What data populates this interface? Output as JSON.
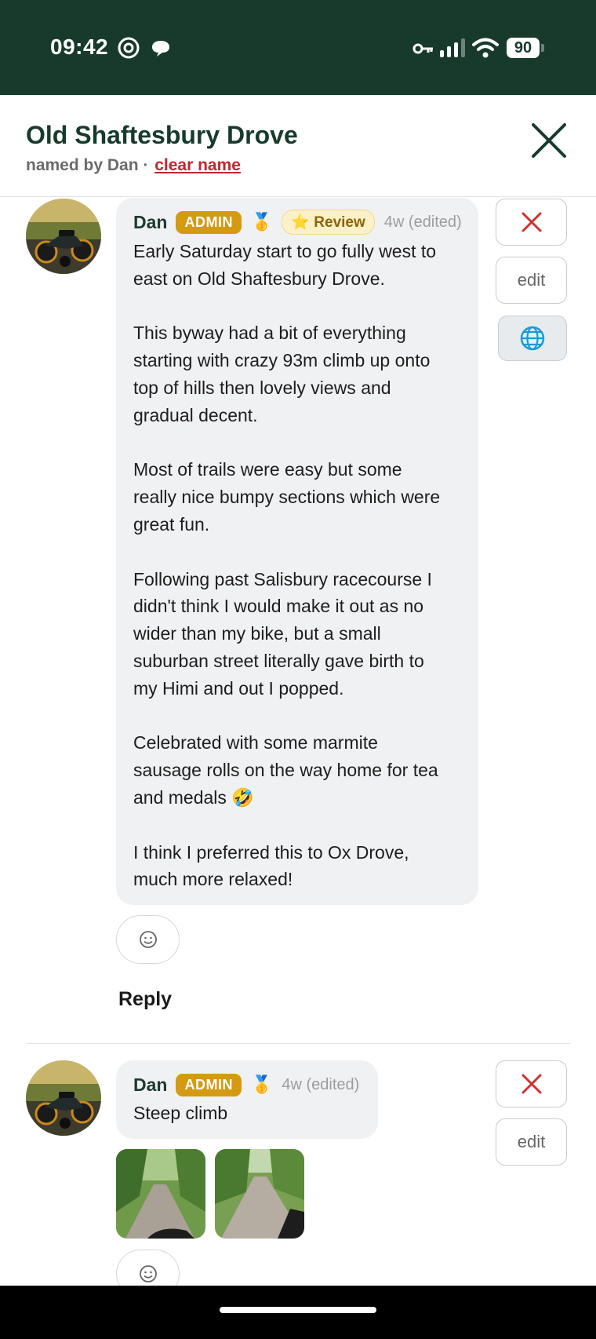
{
  "status_bar": {
    "time": "09:42",
    "battery": "90",
    "icons": [
      "threads-icon",
      "chat-bubble-icon",
      "vpn-key-icon",
      "signal-icon",
      "wifi-icon",
      "battery-icon"
    ]
  },
  "header": {
    "title": "Old Shaftesbury Drove",
    "named_by_prefix": "named by Dan ·",
    "clear_name_label": "clear name",
    "close_icon": "close-icon"
  },
  "colors": {
    "status_bar_bg": "#173a2c",
    "title": "#173a2c",
    "admin_badge": "#d49a12",
    "clear_link": "#c0262d",
    "delete_x": "#d32f2f",
    "bubble_bg": "#f0f1f3"
  },
  "comments": [
    {
      "author": "Dan",
      "badge": "ADMIN",
      "medal": "🥇",
      "review": "⭐ Review",
      "timestamp": "4w (edited)",
      "body": "Early Saturday start to go fully west to\neast on Old Shaftesbury Drove.\n\nThis byway had a bit of everything\nstarting with crazy 93m climb up onto\ntop of hills then lovely views and\ngradual decent.\n\nMost of trails were easy but some\nreally nice bumpy sections which were\ngreat fun.\n\nFollowing past Salisbury racecourse I\ndidn't think I would make it out as no\nwider than my bike, but a small\nsuburban street literally gave birth to\nmy Himi and out I popped.\n\nCelebrated with some marmite\nsausage rolls on the way home for tea\nand medals 🤣\n\nI think I preferred this to Ox Drove,\nmuch more relaxed!",
      "actions": {
        "delete_icon": "close-icon",
        "edit_label": "edit",
        "translate_icon": "globe-icon"
      },
      "reaction_icon": "smiley-icon",
      "reply_label": "Reply"
    },
    {
      "author": "Dan",
      "badge": "ADMIN",
      "medal": "🥇",
      "timestamp": "4w (edited)",
      "body": "Steep climb",
      "actions": {
        "delete_icon": "close-icon",
        "edit_label": "edit"
      },
      "photos": [
        "trail-photo-1",
        "trail-photo-2"
      ],
      "reaction_icon": "smiley-icon"
    }
  ]
}
